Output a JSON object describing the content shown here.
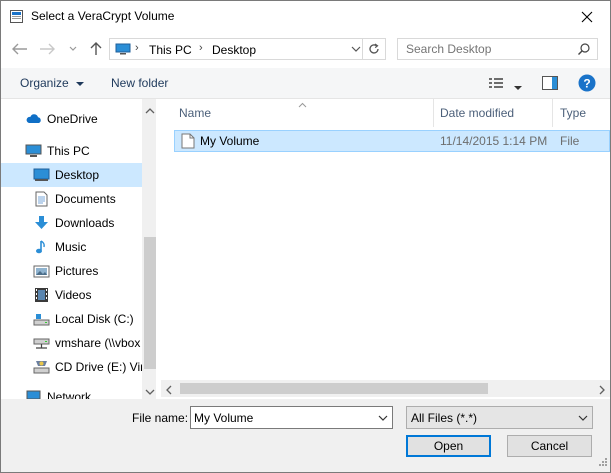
{
  "window": {
    "title": "Select a VeraCrypt Volume"
  },
  "address": {
    "crumbs": [
      "This PC",
      "Desktop"
    ]
  },
  "search": {
    "placeholder": "Search Desktop"
  },
  "toolbar": {
    "organize": "Organize",
    "new_folder": "New folder"
  },
  "nav": {
    "items": [
      {
        "label": "OneDrive",
        "icon": "cloud-icon"
      },
      {
        "label": "This PC",
        "icon": "computer-icon"
      },
      {
        "label": "Desktop",
        "icon": "desktop-icon",
        "selected": true
      },
      {
        "label": "Documents",
        "icon": "documents-icon"
      },
      {
        "label": "Downloads",
        "icon": "downloads-icon"
      },
      {
        "label": "Music",
        "icon": "music-icon"
      },
      {
        "label": "Pictures",
        "icon": "pictures-icon"
      },
      {
        "label": "Videos",
        "icon": "videos-icon"
      },
      {
        "label": "Local Disk (C:)",
        "icon": "drive-icon"
      },
      {
        "label": "vmshare (\\\\vbox",
        "icon": "network-drive-icon"
      },
      {
        "label": "CD Drive (E:) Virt",
        "icon": "cd-drive-icon"
      },
      {
        "label": "Network",
        "icon": "network-icon"
      }
    ]
  },
  "columns": {
    "name": "Name",
    "date": "Date modified",
    "type": "Type"
  },
  "files": [
    {
      "name": "My Volume",
      "date": "11/14/2015 1:14 PM",
      "type": "File"
    }
  ],
  "bottom": {
    "filename_label": "File name:",
    "filename_value": "My Volume",
    "filter": "All Files (*.*)",
    "open": "Open",
    "cancel": "Cancel"
  },
  "colors": {
    "selection": "#cce8ff",
    "accent": "#0078d7",
    "help": "#1a73c9"
  }
}
